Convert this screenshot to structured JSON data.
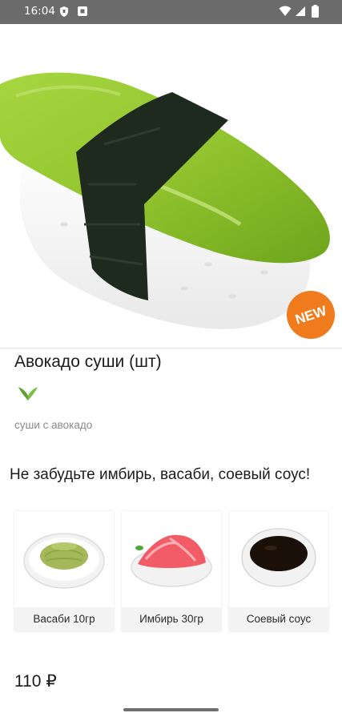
{
  "status_bar": {
    "time": "16:04"
  },
  "product": {
    "badge": "NEW",
    "title": "Авокадо суши (шт)",
    "description": "суши с авокадо",
    "price": "110 ₽"
  },
  "upsell": {
    "title": "Не забудьте имбирь, васаби, соевый соус!",
    "items": [
      {
        "label": "Васаби 10гр"
      },
      {
        "label": "Имбирь 30гр"
      },
      {
        "label": "Соевый соус"
      }
    ]
  },
  "colors": {
    "badge": "#f07b1d",
    "veg_icon": "#5fa337",
    "avocado": "#9ccc3c"
  }
}
